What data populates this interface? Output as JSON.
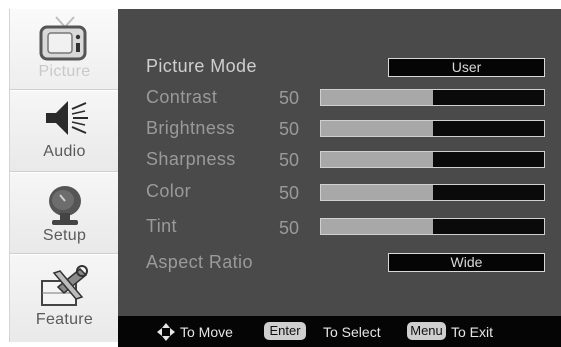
{
  "sidebar": {
    "items": [
      {
        "label": "Picture",
        "icon": "tv-icon",
        "active": true
      },
      {
        "label": "Audio",
        "icon": "speaker-icon",
        "active": false
      },
      {
        "label": "Setup",
        "icon": "satellite-dish-icon",
        "active": false
      },
      {
        "label": "Feature",
        "icon": "tools-icon",
        "active": false
      }
    ]
  },
  "picture_menu": {
    "picture_mode": {
      "label": "Picture Mode",
      "value": "User"
    },
    "contrast": {
      "label": "Contrast",
      "value": "50",
      "level": 0.5
    },
    "brightness": {
      "label": "Brightness",
      "value": "50",
      "level": 0.5
    },
    "sharpness": {
      "label": "Sharpness",
      "value": "50",
      "level": 0.5
    },
    "color": {
      "label": "Color",
      "value": "50",
      "level": 0.5
    },
    "tint": {
      "label": "Tint",
      "value": "50",
      "level": 0.5
    },
    "aspect_ratio": {
      "label": "Aspect Ratio",
      "value": "Wide"
    }
  },
  "footer": {
    "move_text": "To Move",
    "enter_key": "Enter",
    "select_text": "To Select",
    "menu_key": "Menu",
    "exit_text": "To Exit"
  },
  "colors": {
    "panel": "#4a4a4a",
    "slider_fill": "#a8a8a8",
    "slider_track": "#0a0a0a",
    "footer": "#050505"
  }
}
